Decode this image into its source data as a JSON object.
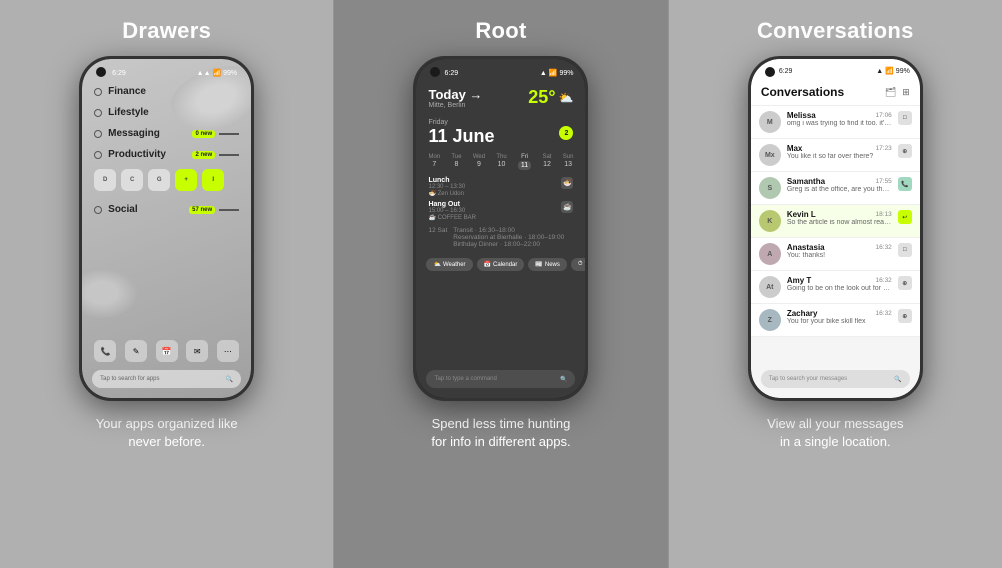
{
  "sections": [
    {
      "id": "drawers",
      "title": "Drawers",
      "caption": "Your apps organized like\nnever before.",
      "phone": {
        "status": {
          "time": "6:29",
          "battery": "99%"
        },
        "drawers": [
          {
            "label": "Finance",
            "badge": null
          },
          {
            "label": "Lifestyle",
            "badge": null
          },
          {
            "label": "Messaging",
            "badge": "0 new"
          },
          {
            "label": "Productivity",
            "badge": "2 new"
          },
          {
            "label": "Social",
            "badge": "57 new"
          }
        ],
        "apps": [
          "Docs",
          "Cal",
          "Gmail",
          "New Tab",
          "Insights"
        ],
        "search_placeholder": "Tap to search for apps"
      }
    },
    {
      "id": "root",
      "title": "Root",
      "caption": "Spend less time hunting\nfor info in different apps.",
      "phone": {
        "status": {
          "time": "6:29",
          "battery": "99%"
        },
        "today_label": "Today →",
        "location": "Mitte, Berlin",
        "temperature": "25°",
        "day_label": "Friday",
        "date_big": "11 June",
        "badge": "2",
        "week_days": [
          "Mon",
          "Tue",
          "Wed",
          "Thu",
          "Fri",
          "Sat",
          "Sun"
        ],
        "week_nums": [
          "7",
          "8",
          "9",
          "10",
          "11",
          "12",
          "13"
        ],
        "active_day": 4,
        "events": [
          {
            "name": "Lunch",
            "time": "12:30 - 13:30",
            "location": "Zen Udon"
          },
          {
            "name": "Hang Out",
            "time": "15:00 - 16:30",
            "location": "COFFEE BAR"
          }
        ],
        "event_next": {
          "date": "12 Sat",
          "items": [
            {
              "name": "Transit",
              "time": "16:30 - 18:00"
            },
            {
              "name": "Reservation at Bierhalle",
              "time": "18:00 - 19:00"
            },
            {
              "name": "Birthday Dinner",
              "time": "18:00 - 22:00"
            }
          ]
        },
        "chips": [
          "Weather",
          "Calendar",
          "News",
          "Tim"
        ],
        "command_placeholder": "Tap to type a command"
      }
    },
    {
      "id": "conversations",
      "title": "Conversations",
      "caption": "View all your messages\nin a single location.",
      "phone": {
        "status": {
          "time": "6:29",
          "battery": "99%"
        },
        "header": "Conversations",
        "conversations": [
          {
            "name": "Melissa",
            "time": "17:06",
            "msg": "omg i was trying to find it too. it's crazy, someone...",
            "indicator": "default",
            "initials": "M"
          },
          {
            "name": "Max",
            "time": "17:23",
            "msg": "You like it so far over there?",
            "indicator": "default",
            "initials": "Mx"
          },
          {
            "name": "Samantha",
            "time": "17:55",
            "msg": "Greg is at the office, are you there yet?",
            "indicator": "teal",
            "initials": "S"
          },
          {
            "name": "Kevin L",
            "time": "18:13",
            "msg": "So the article is now almost ready! Do you thi...",
            "indicator": "green",
            "initials": "K"
          },
          {
            "name": "Anastasia",
            "time": "16:32",
            "msg": "You: thanks!",
            "indicator": "default",
            "initials": "A"
          },
          {
            "name": "Amy T",
            "time": "16:32",
            "msg": "Going to be on the look out for these",
            "indicator": "default",
            "initials": "At"
          },
          {
            "name": "Zachary",
            "time": "16:32",
            "msg": "You for your bike skill flex",
            "indicator": "default",
            "initials": "Z"
          }
        ],
        "search_placeholder": "Tap to search your messages"
      }
    }
  ]
}
